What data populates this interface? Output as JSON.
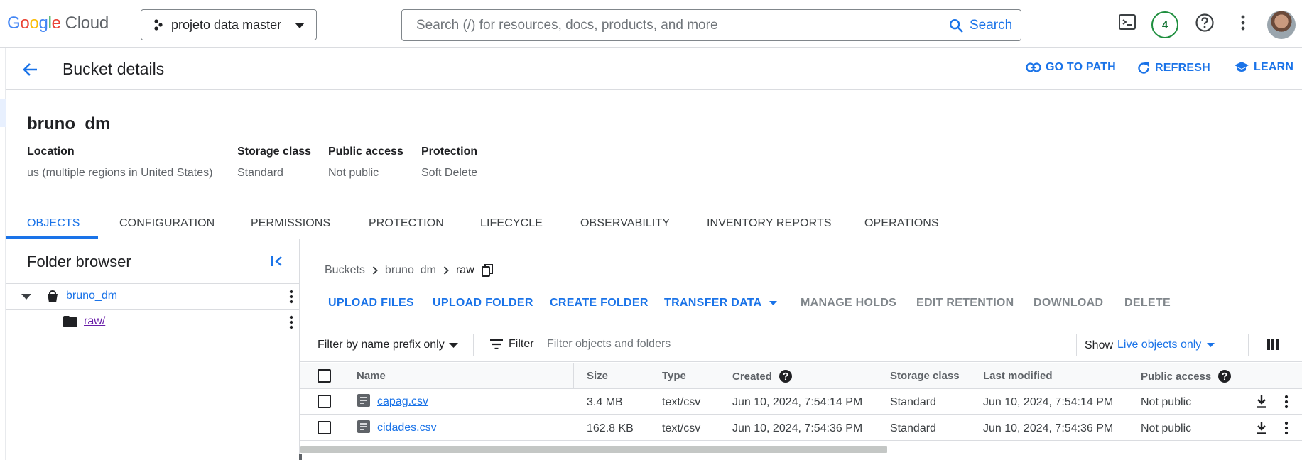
{
  "topbar": {
    "logo_google": "Google",
    "logo_cloud": "Cloud",
    "project": "projeto data master",
    "search_placeholder": "Search (/) for resources, docs, products, and more",
    "search_button": "Search",
    "notifications_count": "4"
  },
  "header": {
    "title": "Bucket details",
    "actions": [
      "GO TO PATH",
      "REFRESH",
      "LEARN"
    ]
  },
  "bucket": {
    "name": "bruno_dm",
    "fields": [
      {
        "label": "Location",
        "value": "us (multiple regions in United States)"
      },
      {
        "label": "Storage class",
        "value": "Standard"
      },
      {
        "label": "Public access",
        "value": "Not public"
      },
      {
        "label": "Protection",
        "value": "Soft Delete"
      }
    ]
  },
  "tabs": [
    "OBJECTS",
    "CONFIGURATION",
    "PERMISSIONS",
    "PROTECTION",
    "LIFECYCLE",
    "OBSERVABILITY",
    "INVENTORY REPORTS",
    "OPERATIONS"
  ],
  "folder_browser": {
    "title": "Folder browser",
    "items": [
      {
        "label": "bruno_dm"
      },
      {
        "label": "raw/"
      }
    ]
  },
  "breadcrumb": [
    "Buckets",
    "bruno_dm",
    "raw"
  ],
  "actions": [
    "UPLOAD FILES",
    "UPLOAD FOLDER",
    "CREATE FOLDER",
    "TRANSFER DATA",
    "MANAGE HOLDS",
    "EDIT RETENTION",
    "DOWNLOAD",
    "DELETE"
  ],
  "filter": {
    "prefix_mode": "Filter by name prefix only",
    "filter_label": "Filter",
    "placeholder": "Filter objects and folders",
    "show_label": "Show",
    "show_value": "Live objects only"
  },
  "table": {
    "columns": [
      "Name",
      "Size",
      "Type",
      "Created",
      "Storage class",
      "Last modified",
      "Public access"
    ],
    "rows": [
      {
        "name": "capag.csv",
        "size": "3.4 MB",
        "type": "text/csv",
        "created": "Jun 10, 2024, 7:54:14 PM",
        "storage_class": "Standard",
        "modified": "Jun 10, 2024, 7:54:14 PM",
        "public_access": "Not public"
      },
      {
        "name": "cidades.csv",
        "size": "162.8 KB",
        "type": "text/csv",
        "created": "Jun 10, 2024, 7:54:36 PM",
        "storage_class": "Standard",
        "modified": "Jun 10, 2024, 7:54:36 PM",
        "public_access": "Not public"
      }
    ]
  },
  "colors": {
    "accent": "#1a73e8",
    "border": "#dadce0",
    "muted": "#5f6368",
    "notify": "#1e8e3e"
  }
}
